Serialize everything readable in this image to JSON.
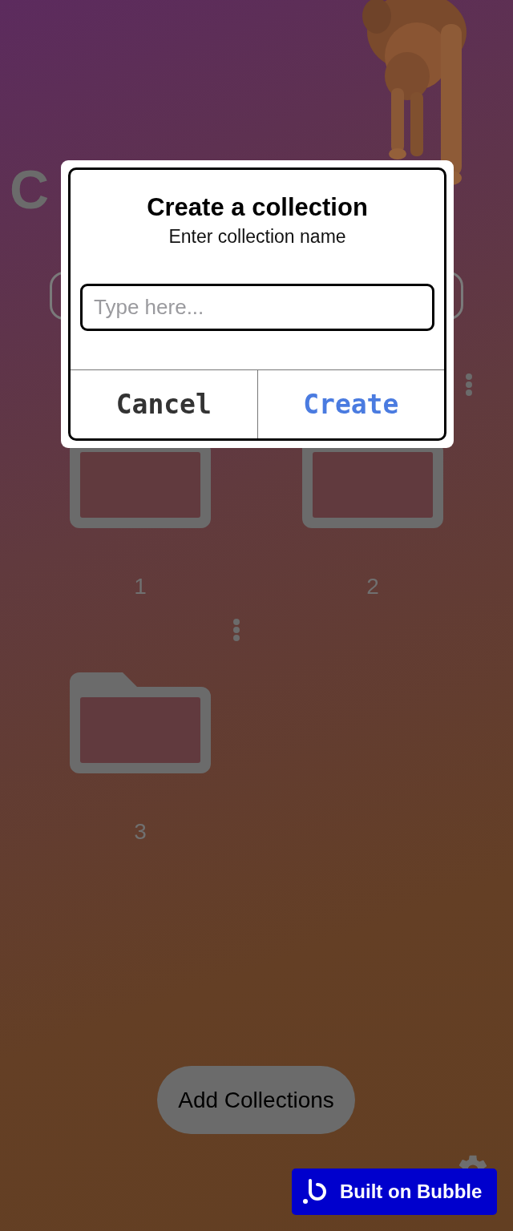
{
  "page_title": "C",
  "collections": [
    {
      "label": "1"
    },
    {
      "label": "2"
    },
    {
      "label": "3"
    }
  ],
  "add_button": "Add Collections",
  "dialog": {
    "title": "Create a collection",
    "subtitle": "Enter collection name",
    "input": {
      "placeholder": "Type here..."
    },
    "buttons": [
      {
        "label": "Cancel",
        "kind": "cancel"
      },
      {
        "label": "Create",
        "kind": "confirm"
      }
    ]
  },
  "badge": "Built on Bubble"
}
